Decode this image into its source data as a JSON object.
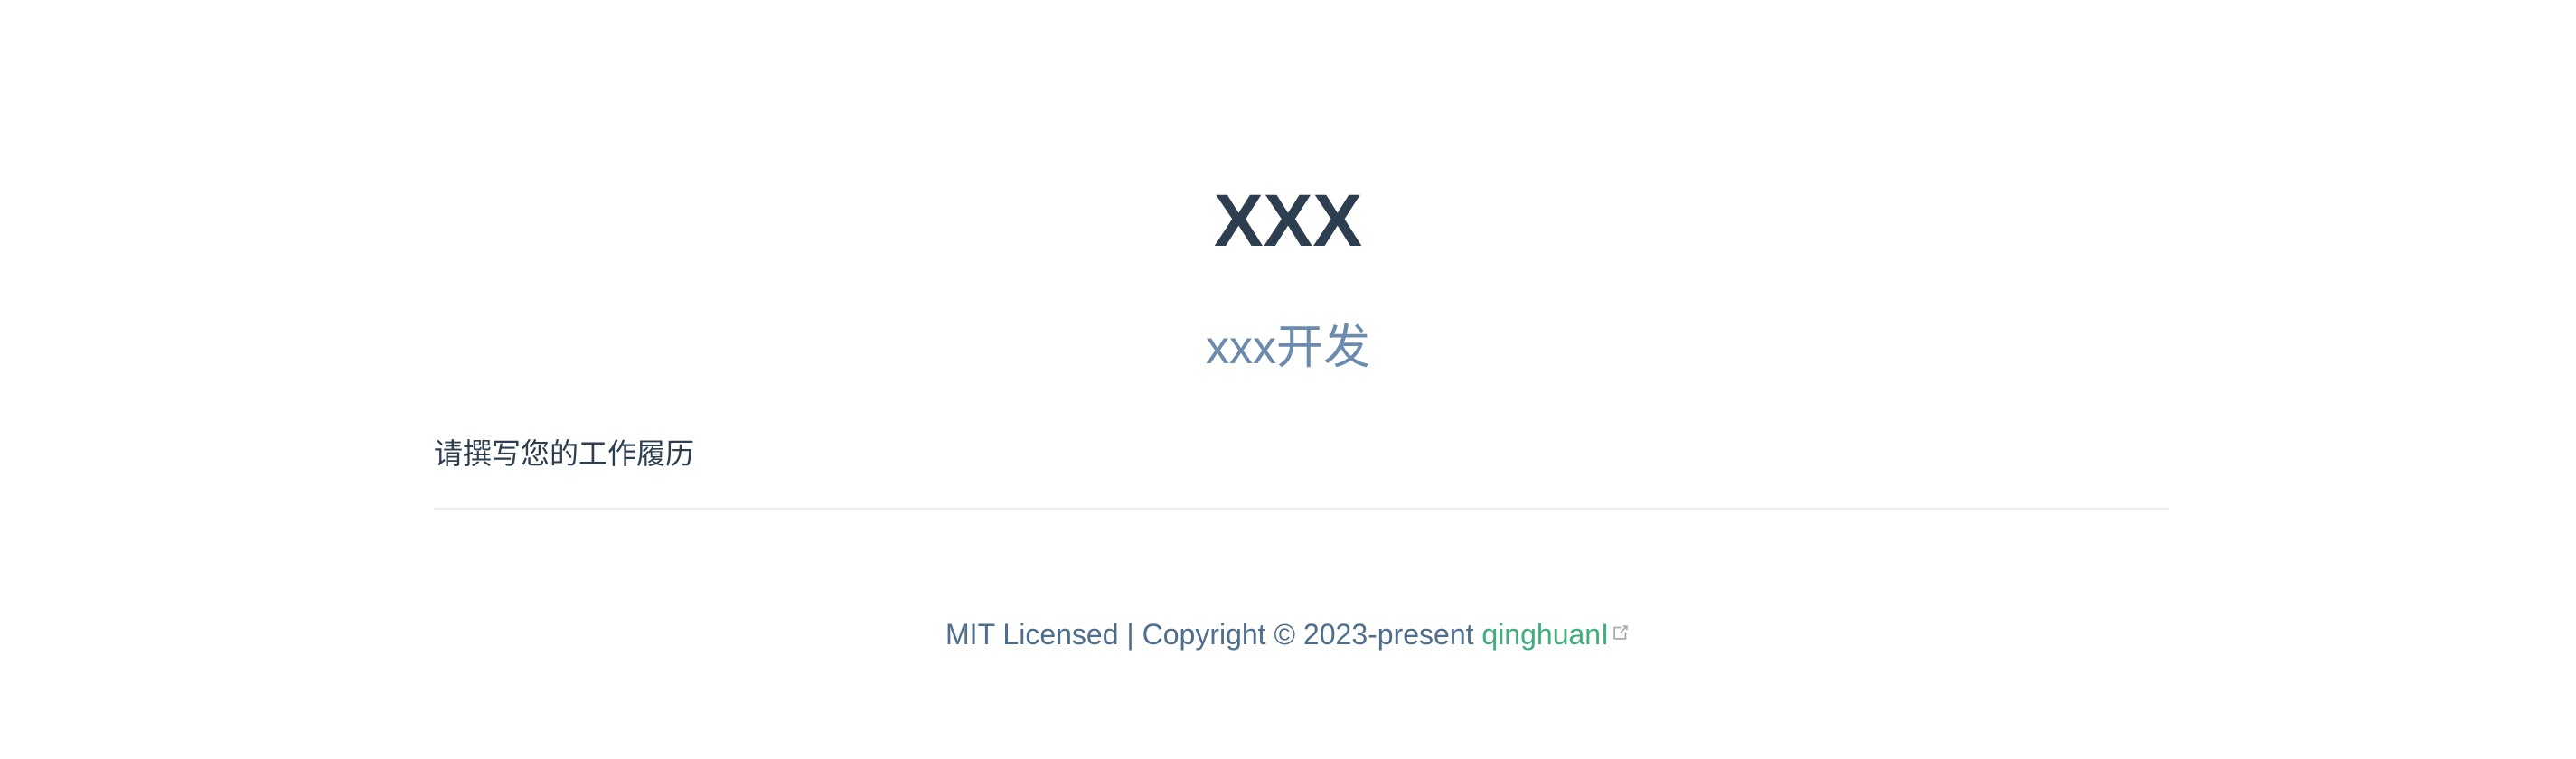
{
  "hero": {
    "title": "XXX",
    "description": "xxx开发"
  },
  "content": {
    "text": "请撰写您的工作履历"
  },
  "footer": {
    "license_text": "MIT Licensed | Copyright © 2023-present ",
    "author_link": "qinghuanI",
    "external_icon": "external-link-icon"
  },
  "colors": {
    "title": "#2c3e50",
    "description": "#6a8bad",
    "accent": "#3eaf7c",
    "divider": "#eaecef",
    "footer": "#4e6e8e"
  }
}
